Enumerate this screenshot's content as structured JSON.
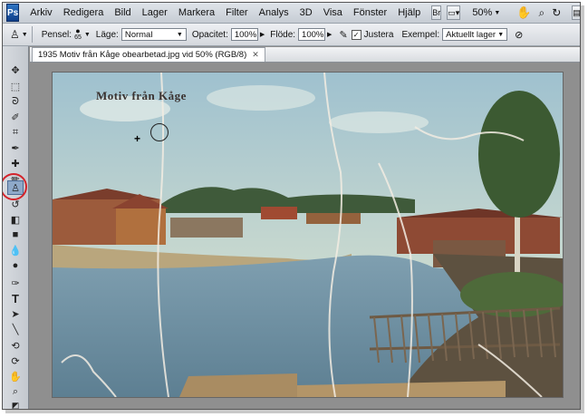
{
  "menu": {
    "logo": "Ps",
    "items": [
      "Arkiv",
      "Redigera",
      "Bild",
      "Lager",
      "Markera",
      "Filter",
      "Analys",
      "3D",
      "Visa",
      "Fönster",
      "Hjälp"
    ],
    "zoom": "50%"
  },
  "options": {
    "brush_label": "Pensel:",
    "brush_size": "65",
    "mode_label": "Läge:",
    "mode_value": "Normal",
    "opacity_label": "Opacitet:",
    "opacity_value": "100%",
    "flow_label": "Flöde:",
    "flow_value": "100%",
    "align_label": "Justera",
    "sample_label": "Exempel:",
    "sample_value": "Aktuellt lager"
  },
  "document": {
    "tab_title": "1935 Motiv från Kåge obearbetad.jpg vid 50% (RGB/8)",
    "caption": "Motiv från Kåge"
  },
  "colors": {
    "highlight": "#d4242b",
    "active_tool": "#8ea9c9"
  },
  "tools": [
    "move-icon",
    "marquee-icon",
    "lasso-icon",
    "quick-select-icon",
    "crop-icon",
    "eyedropper-icon",
    "healing-icon",
    "brush-icon",
    "clone-stamp-icon",
    "history-brush-icon",
    "eraser-icon",
    "gradient-icon",
    "blur-icon",
    "dodge-icon",
    "pen-icon",
    "type-icon",
    "path-select-icon",
    "shape-icon",
    "3d-rotate-icon",
    "3d-camera-icon",
    "hand-icon",
    "zoom-icon",
    "color-swatch-icon"
  ]
}
